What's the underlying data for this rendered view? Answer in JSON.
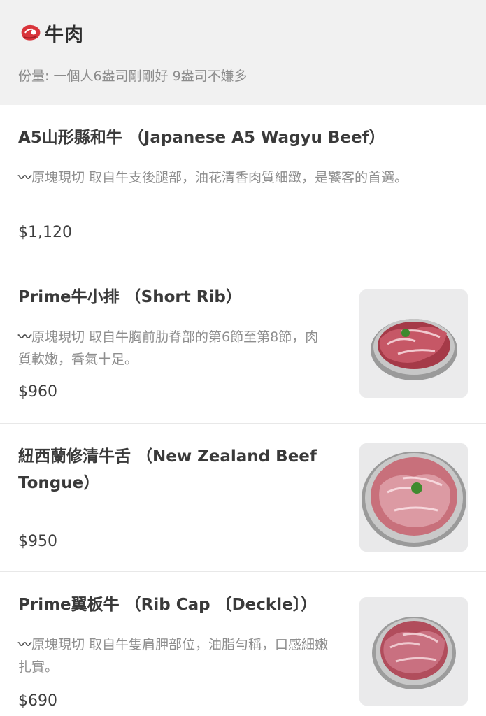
{
  "category": {
    "icon": "steak-icon",
    "title": "牛肉",
    "subtitle": "份量: 一個人6盎司剛剛好 9盎司不嫌多"
  },
  "items": [
    {
      "name": "A5山形縣和牛 （Japanese A5 Wagyu Beef）",
      "desc_mark": "〰",
      "desc": "原塊現切 取自牛支後腿部，油花清香肉質細緻，是饕客的首選。",
      "price": "$1,120",
      "image": null
    },
    {
      "name": "Prime牛小排 （Short Rib）",
      "desc_mark": "〰",
      "desc": "原塊現切 取自牛胸前肋脊部的第6節至第8節，肉質軟嫩，香氣十足。",
      "price": "$960",
      "image": "sliced-beef-plate-image"
    },
    {
      "name": "紐西蘭修清牛舌 （New Zealand Beef Tongue）",
      "desc_mark": "",
      "desc": "",
      "price": "$950",
      "image": "beef-tongue-plate-image"
    },
    {
      "name": "Prime翼板牛 （Rib Cap 〔Deckle〕）",
      "desc_mark": "〰",
      "desc": "原塊現切 取自牛隻肩胛部位，油脂勻稱，口感細嫩扎實。",
      "price": "$690",
      "image": "rib-cap-plate-image"
    }
  ],
  "colors": {
    "header_bg": "#f1f1f1",
    "meat_red": "#d9343b",
    "text_dark": "#3a3a3a",
    "text_muted": "#8e8e8e"
  }
}
